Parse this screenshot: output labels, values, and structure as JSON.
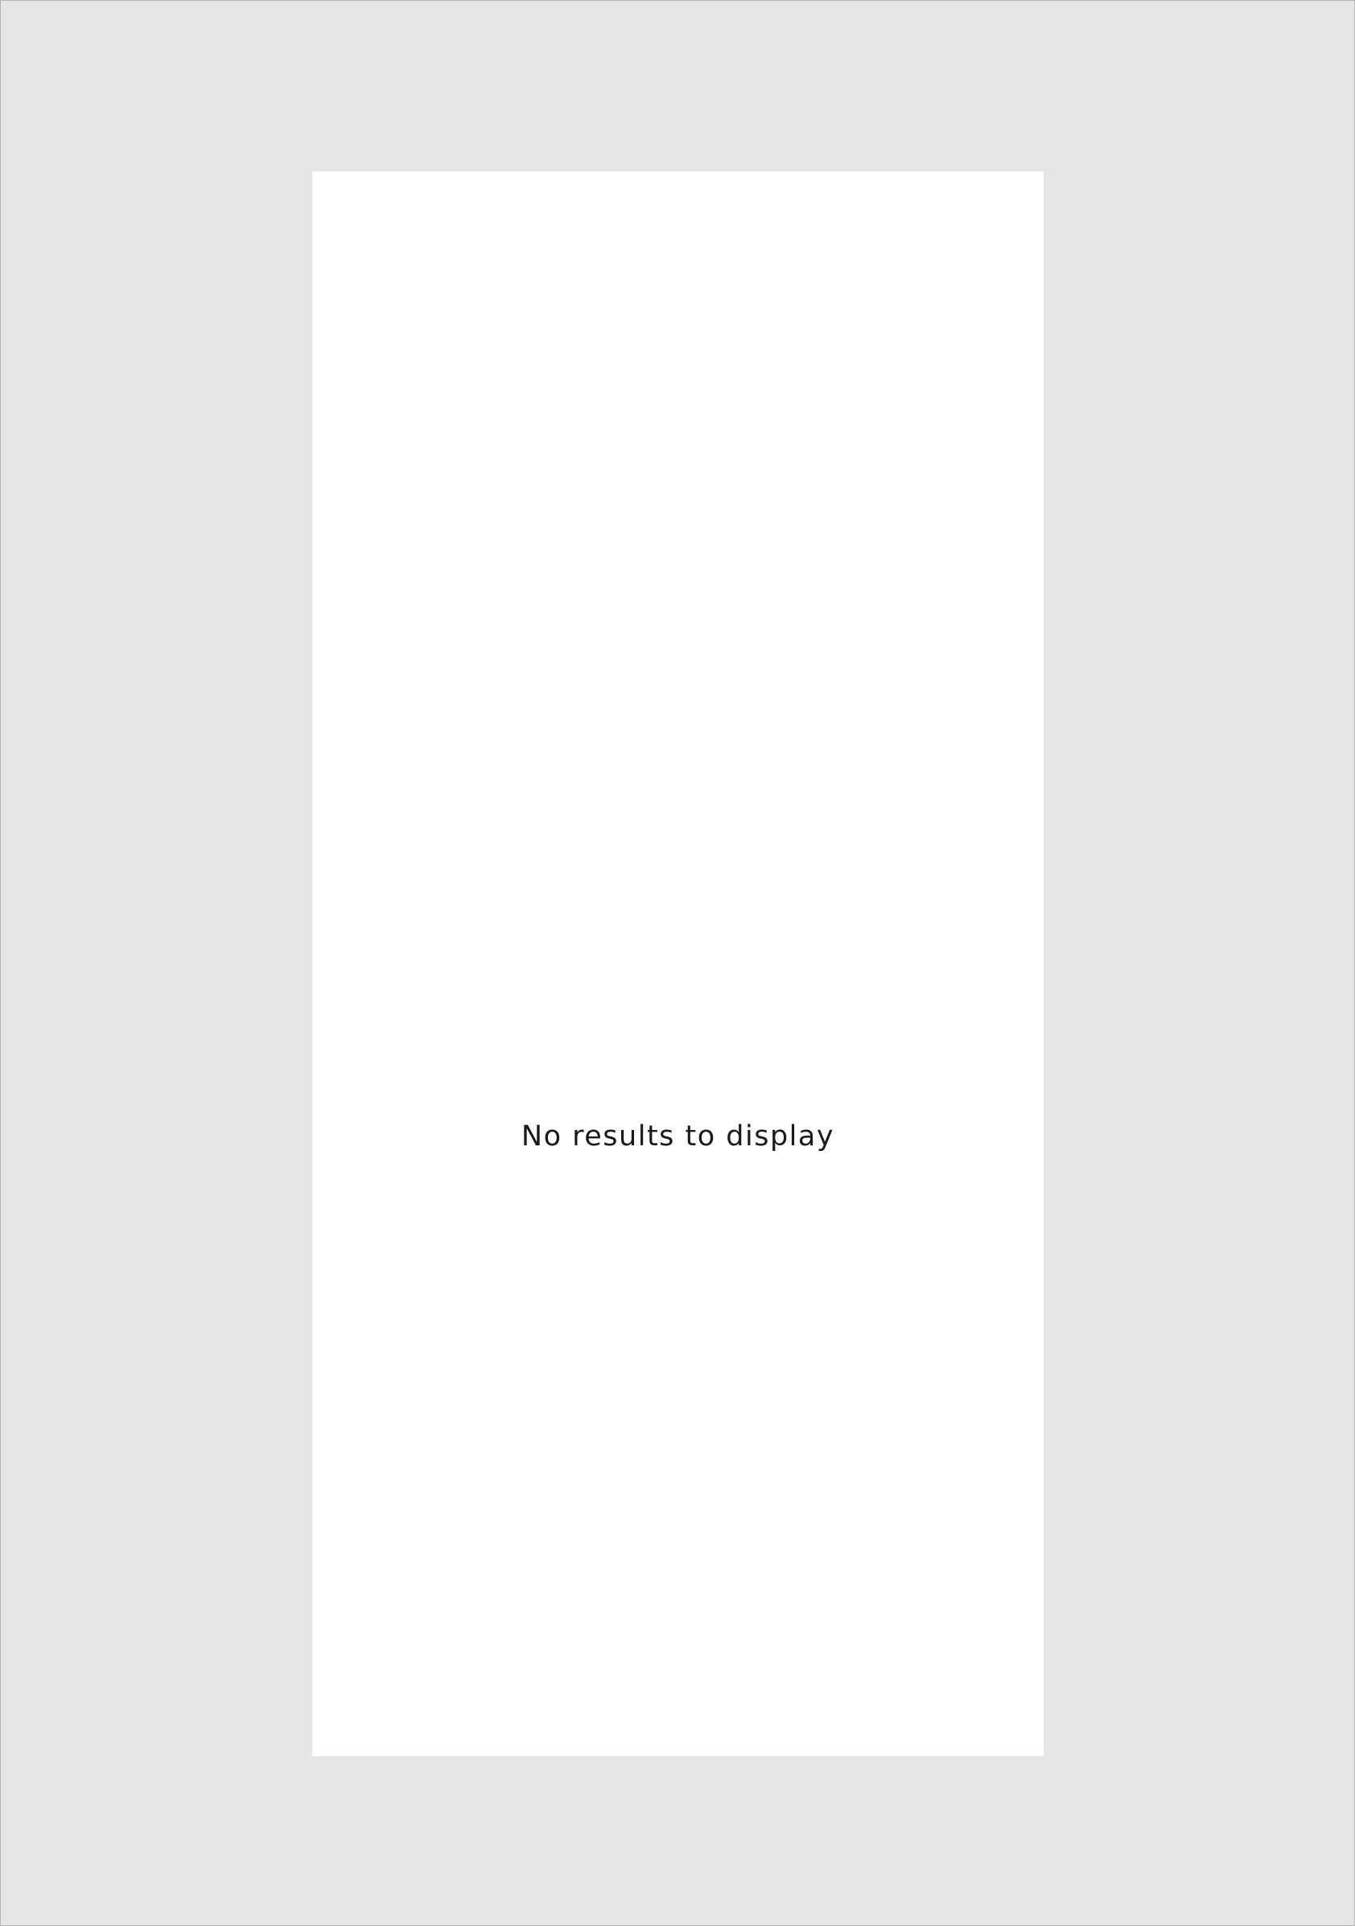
{
  "results_panel": {
    "empty_message": "No results to display"
  },
  "colors": {
    "background": "#e5e5e5",
    "panel": "#ffffff",
    "text": "#1a1a1a",
    "border": "#b3b3b3"
  }
}
